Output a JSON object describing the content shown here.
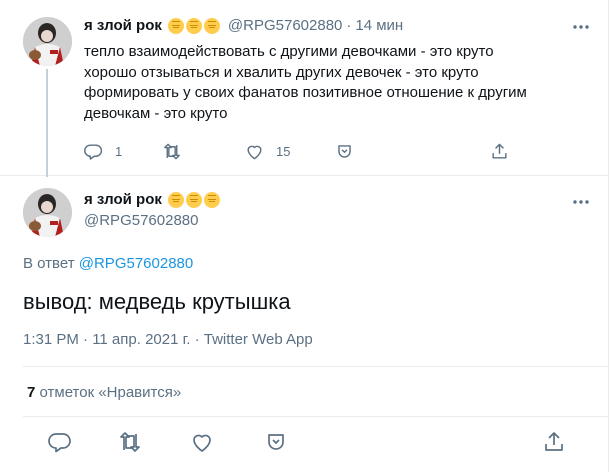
{
  "colors": {
    "accent": "#1b95e0",
    "text": "#0f1419",
    "muted": "#5b7083",
    "border": "#e6ecf0",
    "badge": "#ffcc4d"
  },
  "parent": {
    "display_name": "я злой рок",
    "handle": "@RPG57602880",
    "separator": "·",
    "time": "14 мин",
    "text_lines": [
      "тепло взаимодействовать с другими девочками - это круто",
      "хорошо отзываться и хвалить других девочек - это круто",
      "формировать у своих фанатов позитивное отношение к другим",
      "девочкам - это круто"
    ],
    "reply_count": "1",
    "retweet_count": "",
    "like_count": "15",
    "icons": [
      "reply-icon",
      "retweet-icon",
      "heart-icon",
      "thanks-icon",
      "share-icon",
      "more-icon"
    ]
  },
  "main": {
    "display_name": "я злой рок",
    "handle": "@RPG57602880",
    "reply_prefix": "В ответ ",
    "reply_mention": "@RPG57602880",
    "text": "вывод: медведь крутышка",
    "meta": "1:31 PM · 11 апр. 2021 г. · Twitter Web App",
    "likes_count": "7",
    "likes_label": " отметок «Нравится»",
    "icons": [
      "reply-icon",
      "retweet-icon",
      "heart-icon",
      "thanks-icon",
      "share-icon",
      "more-icon"
    ]
  }
}
